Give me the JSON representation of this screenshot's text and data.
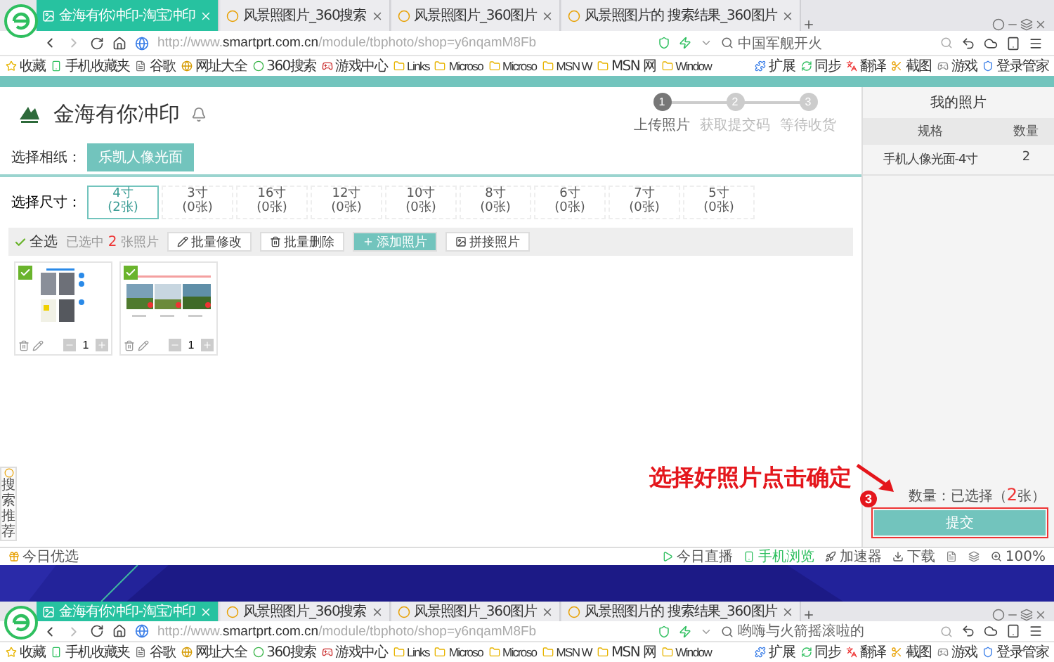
{
  "browsers": [
    {
      "tabs": [
        {
          "title": "金海有你冲印-淘宝冲印",
          "selected": true
        },
        {
          "title": "风景照图片_360搜索",
          "selected": false
        },
        {
          "title": "风景照图片_360图片",
          "selected": false
        },
        {
          "title": "风景照图片的 搜索结果_360图片",
          "selected": false
        }
      ],
      "url": "http://www.**smartprt.com.cn**/module/tbphoto/shop=y6nqamM8Fb",
      "search": {
        "placeholder": "中国军舰开火"
      },
      "bookmarks": [
        {
          "label": "收藏",
          "kind": "star"
        },
        {
          "label": "手机收藏夹",
          "kind": "phone"
        },
        {
          "label": "谷歌",
          "kind": "page"
        },
        {
          "label": "网址大全",
          "kind": "globe"
        },
        {
          "label": "360搜索",
          "kind": "ring"
        },
        {
          "label": "游戏中心",
          "kind": "game"
        },
        {
          "label": "Links",
          "kind": "folder"
        },
        {
          "label": "Microso",
          "kind": "folder"
        },
        {
          "label": "Microso",
          "kind": "folder"
        },
        {
          "label": "MSN W",
          "kind": "folder"
        },
        {
          "label": "MSN 网",
          "kind": "folder"
        },
        {
          "label": "Window",
          "kind": "folder"
        }
      ],
      "tools": [
        "扩展",
        "同步",
        "翻译",
        "截图",
        "游戏",
        "登录管家"
      ]
    },
    {
      "tabs": [
        {
          "title": "金海有你冲印-淘宝冲印",
          "selected": true
        },
        {
          "title": "风景照图片_360搜索",
          "selected": false
        },
        {
          "title": "风景照图片_360图片",
          "selected": false
        },
        {
          "title": "风景照图片的 搜索结果_360图片",
          "selected": false
        }
      ],
      "url": "http://www.**smartprt.com.cn**/module/tbphoto/shop=y6nqamM8Fb",
      "search": {
        "placeholder": "哟嗨与火箭摇滚啦的"
      },
      "bookmarks": [
        {
          "label": "收藏",
          "kind": "star"
        },
        {
          "label": "手机收藏夹",
          "kind": "phone"
        },
        {
          "label": "谷歌",
          "kind": "page"
        },
        {
          "label": "网址大全",
          "kind": "globe"
        },
        {
          "label": "360搜索",
          "kind": "ring"
        },
        {
          "label": "游戏中心",
          "kind": "game"
        },
        {
          "label": "Links",
          "kind": "folder"
        },
        {
          "label": "Microso",
          "kind": "folder"
        },
        {
          "label": "Microso",
          "kind": "folder"
        },
        {
          "label": "MSN W",
          "kind": "folder"
        },
        {
          "label": "MSN 网",
          "kind": "folder"
        },
        {
          "label": "Window",
          "kind": "folder"
        }
      ],
      "tools": [
        "扩展",
        "同步",
        "翻译",
        "截图",
        "游戏",
        "登录管家"
      ]
    }
  ],
  "page": {
    "shop_name": "金海有你冲印",
    "steps": [
      {
        "number": "1",
        "label": "上传照片",
        "selected": true
      },
      {
        "number": "2",
        "label": "获取提交码",
        "selected": false
      },
      {
        "number": "3",
        "label": "等待收货",
        "selected": false
      }
    ],
    "paper": {
      "label": "选择相纸：",
      "options": [
        {
          "label": "乐凯人像光面",
          "selected": true
        }
      ]
    },
    "sizes": {
      "label": "选择尺寸：",
      "options": [
        {
          "size": "4寸",
          "count": "(2张)",
          "selected": true
        },
        {
          "size": "3寸",
          "count": "(0张)",
          "selected": false
        },
        {
          "size": "16寸",
          "count": "(0张)",
          "selected": false
        },
        {
          "size": "12寸",
          "count": "(0张)",
          "selected": false
        },
        {
          "size": "10寸",
          "count": "(0张)",
          "selected": false
        },
        {
          "size": "8寸",
          "count": "(0张)",
          "selected": false
        },
        {
          "size": "6寸",
          "count": "(0张)",
          "selected": false
        },
        {
          "size": "7寸",
          "count": "(0张)",
          "selected": false
        },
        {
          "size": "5寸",
          "count": "(0张)",
          "selected": false
        }
      ]
    },
    "toolbar": {
      "select_all": {
        "label": "全选",
        "checked": true
      },
      "selected_prefix": "已选中",
      "selected_count": "2",
      "selected_suffix": "张照片",
      "buttons": [
        {
          "label": "批量修改",
          "kind": "edit"
        },
        {
          "label": "批量删除",
          "kind": "delete"
        },
        {
          "label": "添加照片",
          "kind": "add"
        },
        {
          "label": "拼接照片",
          "kind": "join"
        }
      ]
    },
    "photos": [
      {
        "checked": true,
        "quantity": "1",
        "kind": "screens"
      },
      {
        "checked": true,
        "quantity": "1",
        "kind": "landscape"
      }
    ]
  },
  "cart": {
    "title": "我的照片",
    "columns": [
      "规格",
      "数量"
    ],
    "rows": [
      [
        "手机人像光面-4寸",
        "2"
      ]
    ],
    "summary_prefix": "数量：已选择（",
    "summary_count": "2",
    "summary_suffix": "张）",
    "submit": "提交"
  },
  "annotation": {
    "text": "选择好照片点击确定",
    "badge": "3"
  },
  "side_widget": {
    "label": "搜索推荐"
  },
  "status_bar": {
    "left": "今日优选",
    "items": [
      {
        "label": "今日直播",
        "kind": "live"
      },
      {
        "label": "手机浏览",
        "kind": "phone"
      },
      {
        "label": "加速器",
        "kind": "speed"
      },
      {
        "label": "下载",
        "kind": "download"
      }
    ],
    "zoom": "100%"
  }
}
